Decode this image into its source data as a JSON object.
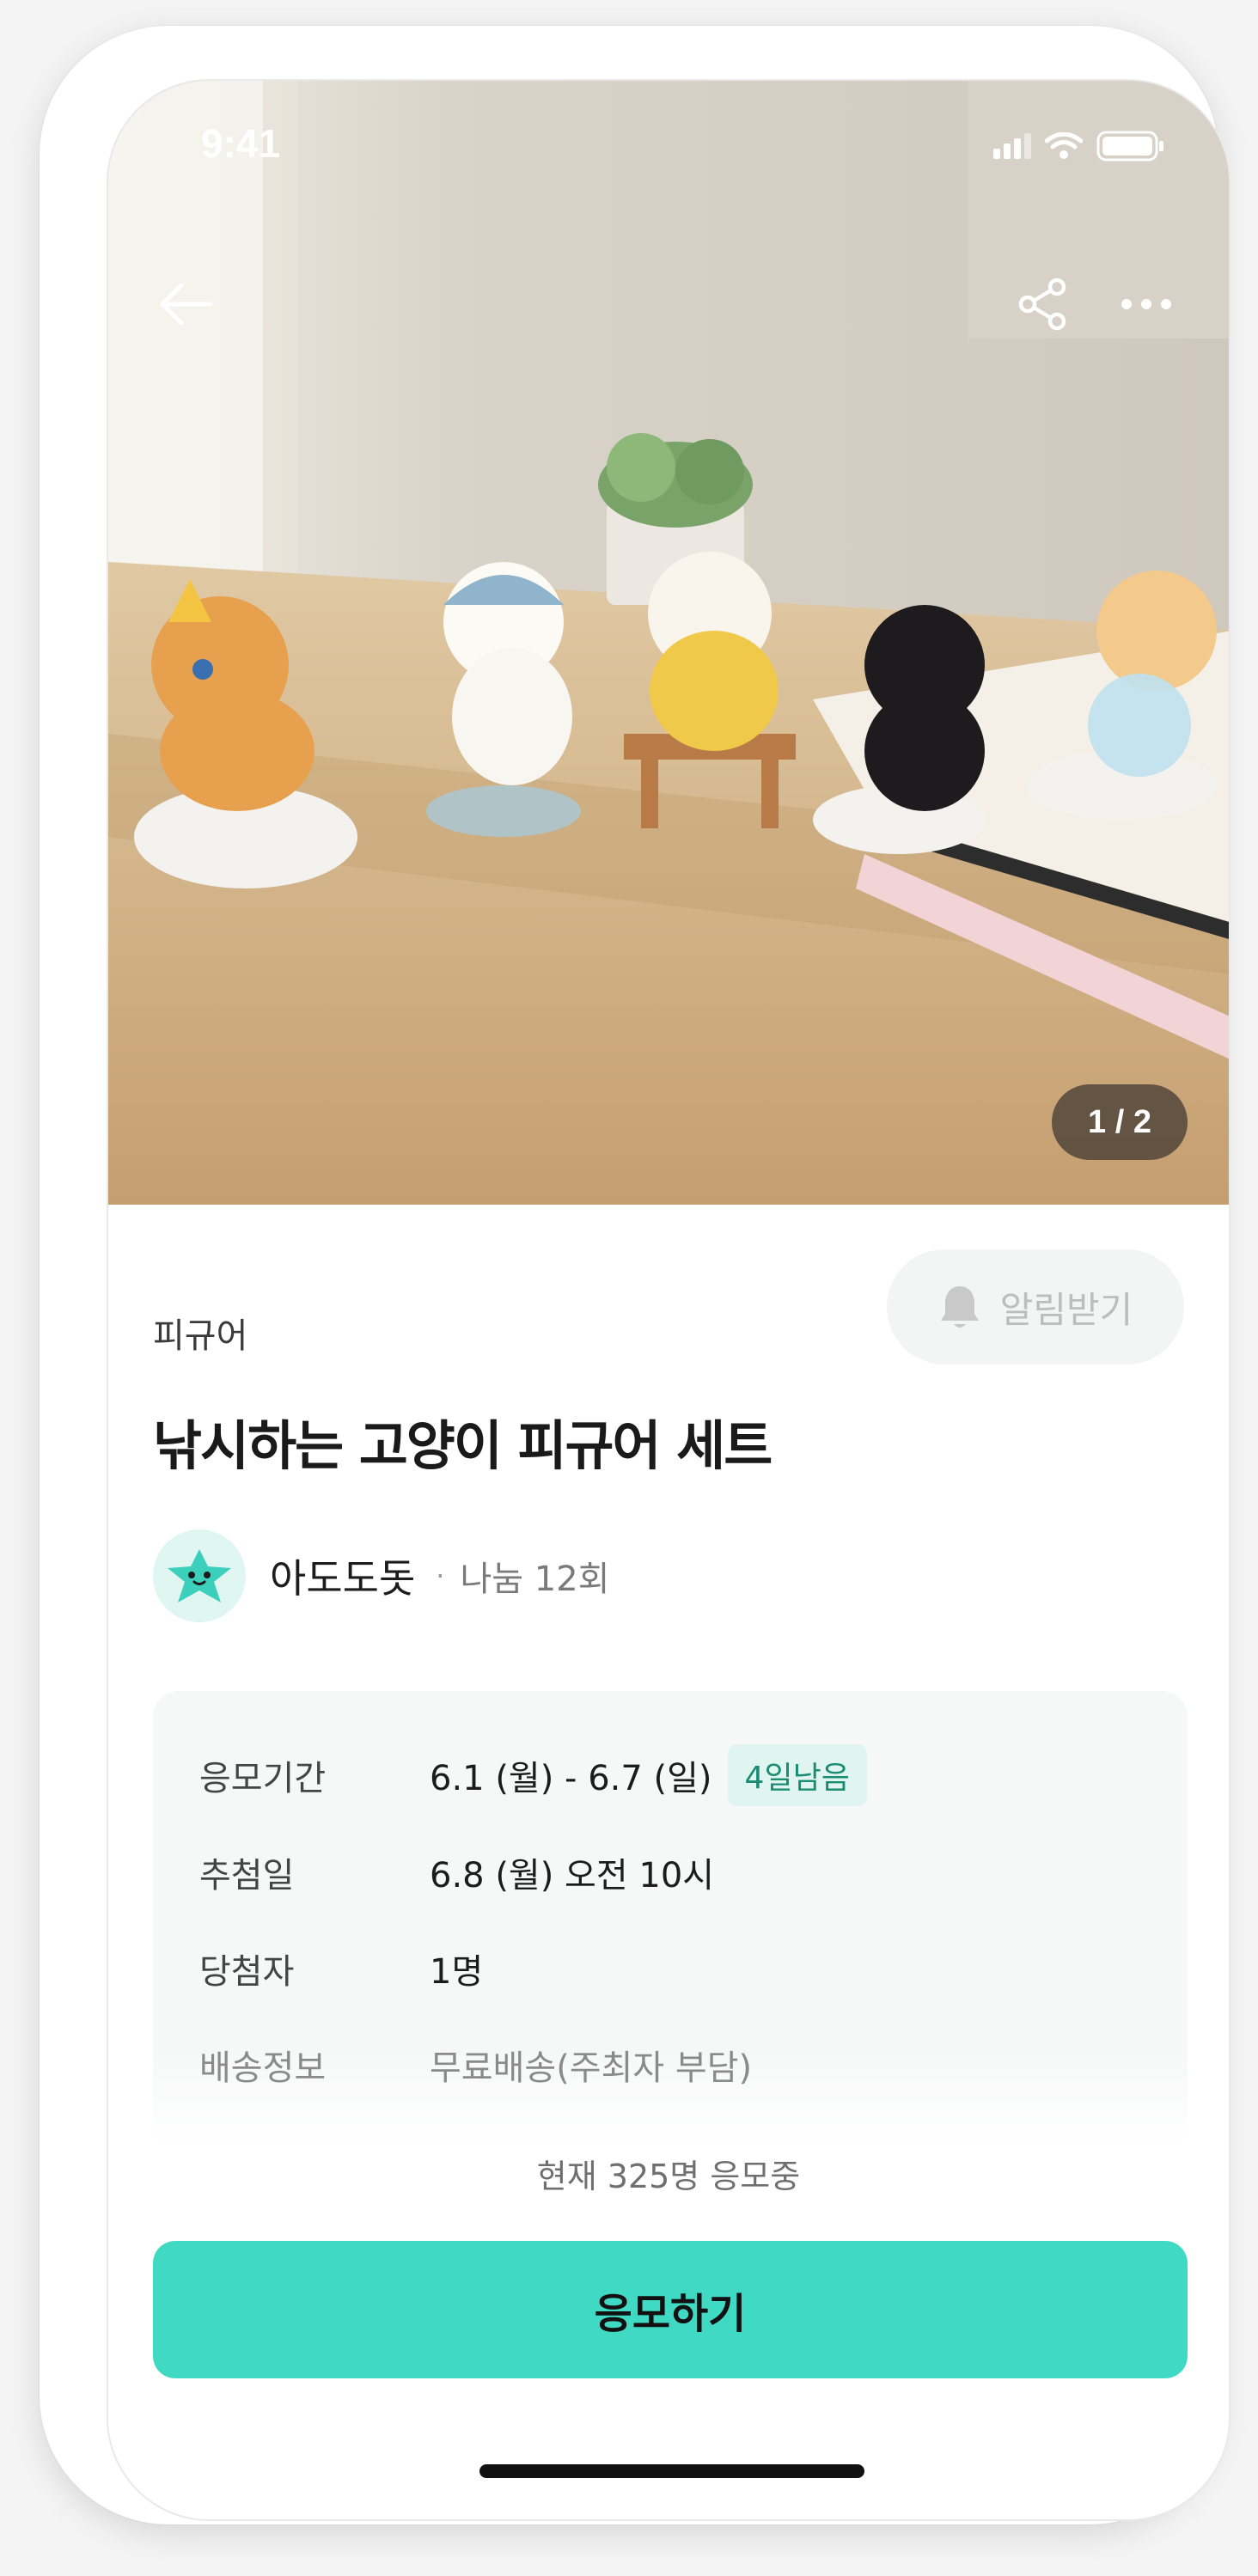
{
  "status_bar": {
    "time": "9:41"
  },
  "hero": {
    "page_counter": "1 / 2",
    "icons": {
      "back": "arrow-left-icon",
      "share": "share-icon",
      "more": "more-icon"
    }
  },
  "product": {
    "category": "피규어",
    "title": "낚시하는 고양이 피규어 세트",
    "notify_label": "알림받기"
  },
  "seller": {
    "name": "아도도돗",
    "separator": "·",
    "share_count": "나눔 12회"
  },
  "info": {
    "period_label": "응모기간",
    "period_value": "6.1 (월) - 6.7 (일)",
    "period_badge": "4일남음",
    "draw_label": "추첨일",
    "draw_value": "6.8 (월) 오전 10시",
    "winners_label": "당첨자",
    "winners_value": "1명",
    "shipping_label": "배송정보",
    "shipping_value": "무료배송(주최자 부담)"
  },
  "applicants_text": "현재 325명 응모중",
  "apply_label": "응모하기",
  "colors": {
    "accent": "#40d9c4",
    "badge_text": "#1a8c72",
    "badge_bg": "#e1f5f0"
  }
}
